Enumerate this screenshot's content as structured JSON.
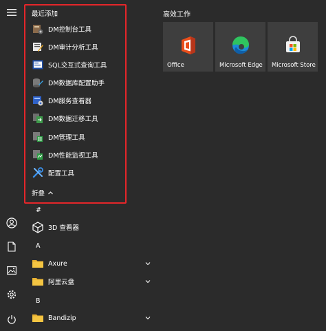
{
  "recent": {
    "heading": "最近添加",
    "items": [
      {
        "label": "DM控制台工具",
        "icon": "dm-console-icon"
      },
      {
        "label": "DM审计分析工具",
        "icon": "dm-audit-icon"
      },
      {
        "label": "SQL交互式查询工具",
        "icon": "sql-query-icon"
      },
      {
        "label": "DM数据库配置助手",
        "icon": "dm-config-assistant-icon"
      },
      {
        "label": "DM服务查看器",
        "icon": "dm-service-viewer-icon"
      },
      {
        "label": "DM数据迁移工具",
        "icon": "dm-migration-icon"
      },
      {
        "label": "DM管理工具",
        "icon": "dm-manager-icon"
      },
      {
        "label": "DM性能监视工具",
        "icon": "dm-monitor-icon"
      },
      {
        "label": "配置工具",
        "icon": "config-tool-icon"
      }
    ],
    "collapse_label": "折叠"
  },
  "apps": {
    "groups": [
      {
        "letter": "#",
        "items": [
          {
            "label": "3D 查看器",
            "icon": "3d-viewer-icon",
            "folder": false
          }
        ]
      },
      {
        "letter": "A",
        "items": [
          {
            "label": "Axure",
            "icon": "folder-icon",
            "folder": true
          },
          {
            "label": "阿里云盘",
            "icon": "folder-icon",
            "folder": true
          }
        ]
      },
      {
        "letter": "B",
        "items": [
          {
            "label": "Bandizip",
            "icon": "folder-icon",
            "folder": true
          }
        ]
      }
    ]
  },
  "tiles": {
    "heading": "高效工作",
    "items": [
      {
        "label": "Office",
        "icon": "office-icon"
      },
      {
        "label": "Microsoft Edge",
        "icon": "edge-icon"
      },
      {
        "label": "Microsoft Store",
        "icon": "store-icon"
      }
    ]
  },
  "rail": [
    "hamburger-icon",
    "user-icon",
    "documents-icon",
    "pictures-icon",
    "settings-icon",
    "power-icon"
  ],
  "colors": {
    "background": "#2b2b2b",
    "tile": "#3e3e3e",
    "highlight": "#e5262a",
    "folder": "#f4c542"
  }
}
